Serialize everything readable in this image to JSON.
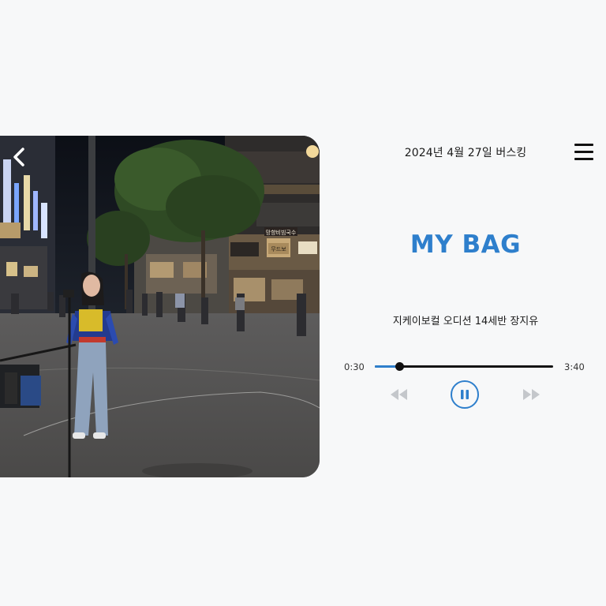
{
  "header": {
    "title": "2024년 4월 27일 버스킹"
  },
  "song": {
    "title": "MY BAG",
    "subtitle": "지케이보컬 오디션 14세반 장지유"
  },
  "player": {
    "current_time": "0:30",
    "total_time": "3:40",
    "progress_fraction": 0.136,
    "state": "playing"
  },
  "media": {
    "storefront_sign_1": "망향비빔국수",
    "storefront_sign_2": "무드보"
  },
  "icons": {
    "back": "chevron-left-icon",
    "menu": "hamburger-menu-icon",
    "rewind": "rewind-icon",
    "pause": "pause-icon",
    "forward": "fast-forward-icon"
  },
  "colors": {
    "accent": "#2e7fcc",
    "background": "#f7f8f9",
    "disabled_control": "#c4c7cb",
    "text": "#1a1a1a"
  }
}
